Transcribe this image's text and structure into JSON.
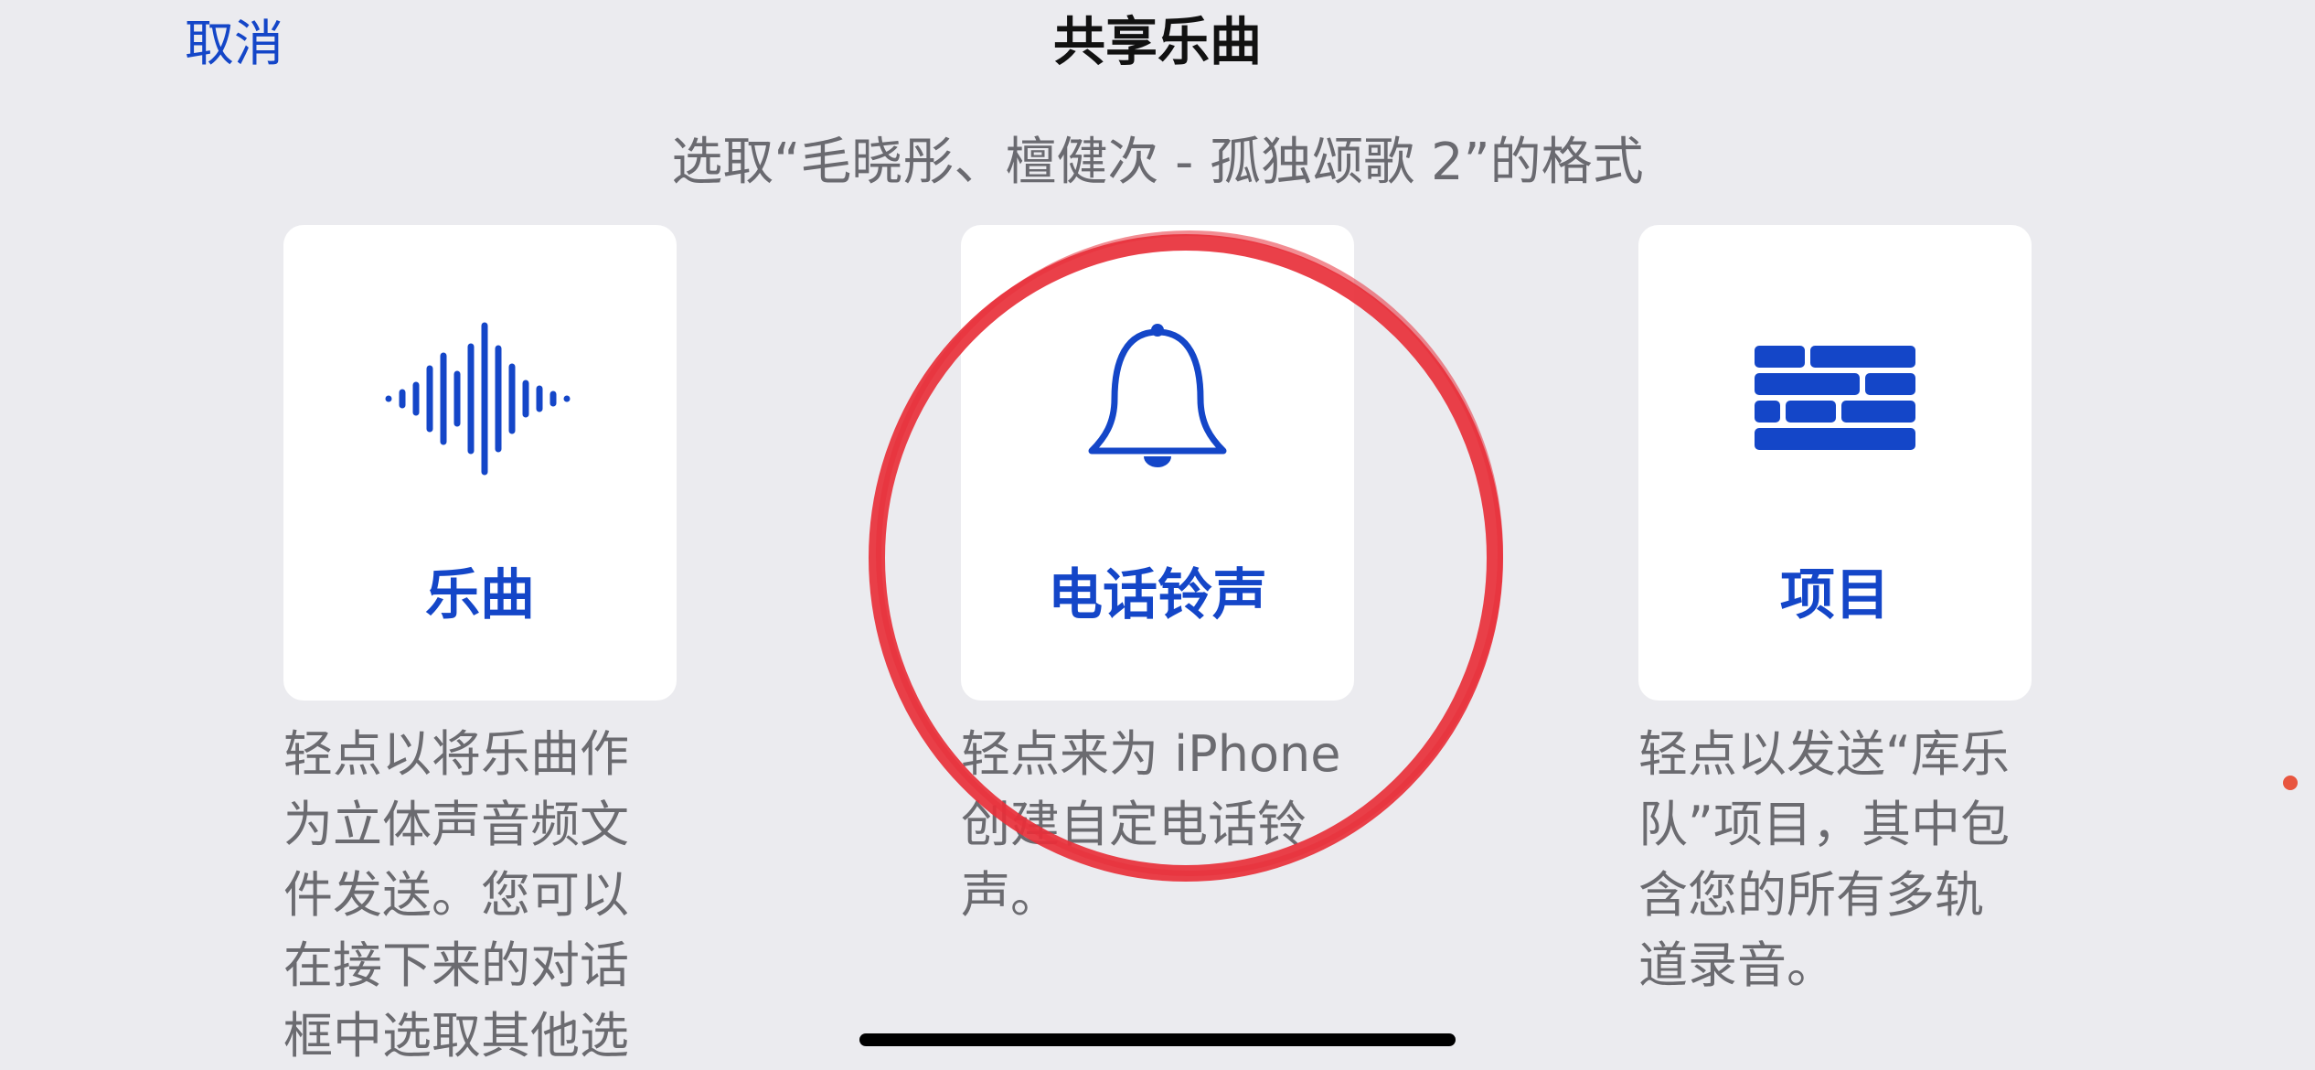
{
  "nav": {
    "cancel_label": "取消",
    "title": "共享乐曲"
  },
  "subtitle": "选取“毛晓彤、檀健次 - 孤独颂歌  2”的格式",
  "cards": [
    {
      "icon": "waveform-icon",
      "label": "乐曲",
      "description": "轻点以将乐曲作为立体声音频文件发送。您可以在接下来的对话框中选取其他选"
    },
    {
      "icon": "bell-icon",
      "label": "电话铃声",
      "description": "轻点来为 iPhone 创建自定电话铃声。"
    },
    {
      "icon": "brick-wall-icon",
      "label": "项目",
      "description": "轻点以发送“库乐队”项目，其中包含您的所有多轨道录音。"
    }
  ],
  "colors": {
    "accent": "#1446c8",
    "background": "#ebebef",
    "card": "#ffffff",
    "annotation": "#e8303a"
  }
}
